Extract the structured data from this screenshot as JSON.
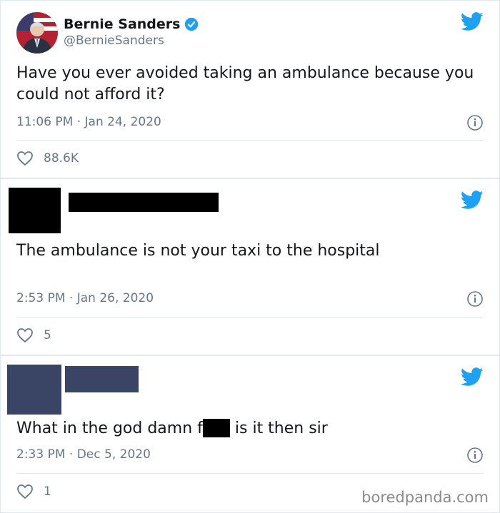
{
  "tweets": [
    {
      "author_name": "Bernie Sanders",
      "author_handle": "@BernieSanders",
      "text": "Have you ever avoided taking an ambulance because you could not afford it?",
      "timestamp": "11:06 PM · Jan 24, 2020",
      "likes": "88.6K"
    },
    {
      "author_name": "",
      "author_handle": "",
      "text": "The ambulance is not your taxi to the hospital",
      "timestamp": "2:53 PM · Jan 26, 2020",
      "likes": "5"
    },
    {
      "author_name": "",
      "author_handle": "",
      "text_before": "What in the god damn f",
      "text_after": " is it then sir",
      "timestamp": "2:33 PM · Dec 5, 2020",
      "likes": "1"
    }
  ],
  "watermark": "boredpanda.com",
  "colors": {
    "twitter_blue": "#1da1f2",
    "secondary_text": "#657786",
    "third_avatar_block": "#3a4566"
  },
  "icons": {
    "logo": "twitter-bird-icon",
    "verified": "verified-badge-icon",
    "info": "info-icon",
    "like": "heart-icon"
  }
}
